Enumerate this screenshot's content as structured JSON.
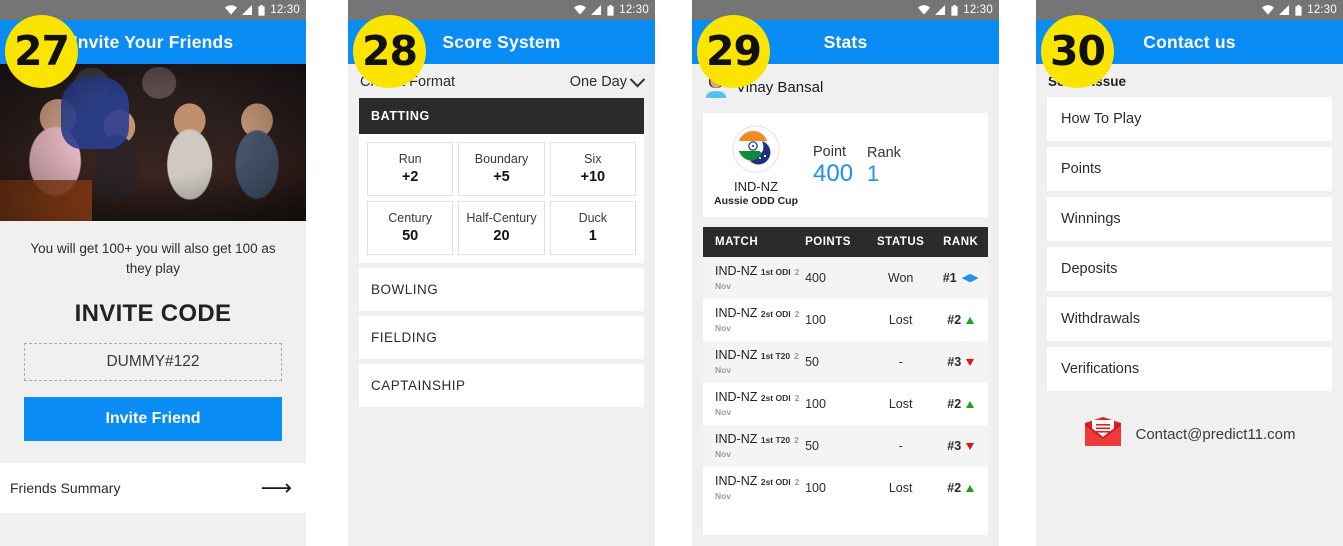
{
  "statusbar": {
    "time": "12:30",
    "icons": [
      "wifi-icon",
      "signal-icon",
      "battery-icon"
    ]
  },
  "colors": {
    "accent_blue": "#0a8cf5",
    "badge_yellow": "#fbe400",
    "dark_header": "#2b2b2b",
    "page_bg": "#f0f0f0",
    "status_gray": "#757575",
    "rank_up_green": "#1aa31a",
    "rank_down_red": "#e21414",
    "mail_red": "#ea2626"
  },
  "screens": [
    {
      "badge": "27",
      "title": "Invite Your Friends",
      "photo_alt": "group-photo",
      "description": "You will get 100+ you will also get 100 as they play",
      "invite_code_label": "INVITE CODE",
      "invite_code_value": "DUMMY#122",
      "invite_button": "Invite Friend",
      "footer_label": "Friends Summary",
      "footer_icon": "arrow-right-icon"
    },
    {
      "badge": "28",
      "title": "Score System",
      "format_label": "Cricket Format",
      "format_value": "One Day",
      "format_icon": "chevron-down-icon",
      "batting_header": "BATTING",
      "batting_cells": [
        {
          "name": "Run",
          "value": "+2"
        },
        {
          "name": "Boundary",
          "value": "+5"
        },
        {
          "name": "Six",
          "value": "+10"
        },
        {
          "name": "Century",
          "value": "50"
        },
        {
          "name": "Half-Century",
          "value": "20"
        },
        {
          "name": "Duck",
          "value": "1"
        }
      ],
      "collapsed_sections": [
        "BOWLING",
        "FIELDING",
        "CAPTAINSHIP"
      ]
    },
    {
      "badge": "29",
      "title": "Stats",
      "user_icon": "avatar-icon",
      "user_name": "Vinay Bansal",
      "summary": {
        "flag_icon": "india-newzealand-flag-icon",
        "match_code": "IND-NZ",
        "cup_name": "Aussie ODD Cup",
        "point_label": "Point",
        "point_value": "400",
        "rank_label": "Rank",
        "rank_value": "1"
      },
      "table": {
        "headers": [
          "MATCH",
          "POINTS",
          "STATUS",
          "RANK"
        ],
        "rows": [
          {
            "match": "IND-NZ",
            "format": "1st ODI",
            "date": "2 Nov",
            "points": "400",
            "status": "Won",
            "rank": "#1",
            "trend": "flat"
          },
          {
            "match": "IND-NZ",
            "format": "2st ODI",
            "date": "2 Nov",
            "points": "100",
            "status": "Lost",
            "rank": "#2",
            "trend": "up"
          },
          {
            "match": "IND-NZ",
            "format": "1st T20",
            "date": "2 Nov",
            "points": "50",
            "status": "-",
            "rank": "#3",
            "trend": "down"
          },
          {
            "match": "IND-NZ",
            "format": "2st ODI",
            "date": "2 Nov",
            "points": "100",
            "status": "Lost",
            "rank": "#2",
            "trend": "up"
          },
          {
            "match": "IND-NZ",
            "format": "1st T20",
            "date": "2 Nov",
            "points": "50",
            "status": "-",
            "rank": "#3",
            "trend": "down"
          },
          {
            "match": "IND-NZ",
            "format": "2st ODI",
            "date": "2 Nov",
            "points": "100",
            "status": "Lost",
            "rank": "#2",
            "trend": "up"
          }
        ]
      }
    },
    {
      "badge": "30",
      "title": "Contact us",
      "select_issue_label": "Select Issue",
      "issues": [
        "How To Play",
        "Points",
        "Winnings",
        "Deposits",
        "Withdrawals",
        "Verifications"
      ],
      "contact_icon": "email-icon",
      "contact_email": "Contact@predict11.com"
    }
  ]
}
